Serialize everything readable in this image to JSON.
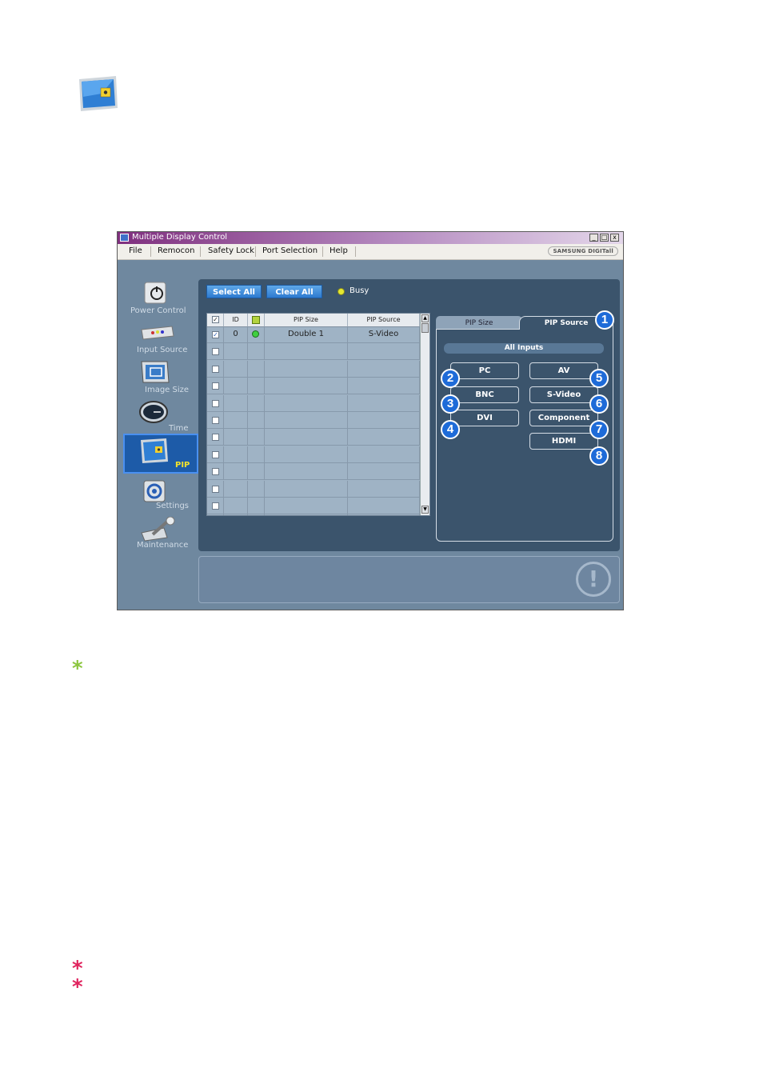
{
  "window": {
    "title": "Multiple Display Control",
    "brand": "SAMSUNG DIGITall",
    "buttons": [
      "_",
      "□",
      "x"
    ]
  },
  "menu": [
    "File",
    "Remocon",
    "Safety Lock",
    "Port Selection",
    "Help"
  ],
  "sidebar": [
    {
      "label": "Power Control",
      "icon": "power-control-icon"
    },
    {
      "label": "Input Source",
      "icon": "input-source-icon"
    },
    {
      "label": "Image Size",
      "icon": "image-size-icon"
    },
    {
      "label": "Time",
      "icon": "clock-icon"
    },
    {
      "label": "PIP",
      "icon": "pip-icon",
      "selected": true
    },
    {
      "label": "Settings",
      "icon": "settings-icon"
    },
    {
      "label": "Maintenance",
      "icon": "maintenance-icon"
    }
  ],
  "toolbar": {
    "select_all": "Select All",
    "clear_all": "Clear All",
    "busy": "Busy"
  },
  "grid": {
    "columns": [
      "",
      "ID",
      "",
      "PIP Size",
      "PIP Source"
    ],
    "rows": [
      {
        "checked": true,
        "id": "0",
        "status": "on",
        "pip_size": "Double 1",
        "pip_source": "S-Video"
      }
    ],
    "empty_rows": 11
  },
  "tabs": {
    "pip_size": "PIP Size",
    "pip_source": "PIP Source"
  },
  "source_panel": {
    "header": "All Inputs",
    "buttons": {
      "pc": "PC",
      "bnc": "BNC",
      "dvi": "DVI",
      "av": "AV",
      "svideo": "S-Video",
      "component": "Component",
      "hdmi": "HDMI"
    }
  },
  "callouts": [
    "1",
    "2",
    "3",
    "4",
    "5",
    "6",
    "7",
    "8"
  ],
  "colors": {
    "callout": "#1e6bd8",
    "note_star": "#8cc63f",
    "warning_star": "#e0245e",
    "panel": "#3b546c"
  }
}
